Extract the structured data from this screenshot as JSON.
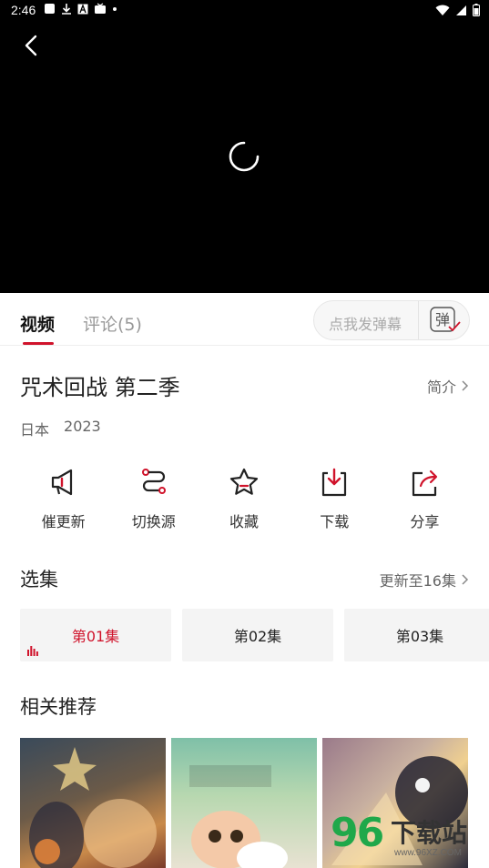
{
  "status_bar": {
    "time": "2:46",
    "left_icons": [
      "app-icon",
      "download-icon",
      "a-icon",
      "tv-icon",
      "dot-icon"
    ],
    "right_icons": [
      "wifi-icon",
      "signal-icon",
      "battery-icon"
    ]
  },
  "player": {
    "back_icon": "chevron-left-icon",
    "loading_icon": "spinner-icon"
  },
  "tabs": [
    {
      "label": "视频",
      "active": true
    },
    {
      "label": "评论(5)",
      "active": false
    }
  ],
  "danmu": {
    "placeholder": "点我发弹幕",
    "button_glyph": "弹"
  },
  "show": {
    "title": "咒术回战 第二季",
    "intro_label": "简介",
    "region": "日本",
    "year": "2023"
  },
  "actions": [
    {
      "label": "催更新",
      "icon": "megaphone-icon"
    },
    {
      "label": "切换源",
      "icon": "switch-source-icon"
    },
    {
      "label": "收藏",
      "icon": "star-icon"
    },
    {
      "label": "下载",
      "icon": "download-icon"
    },
    {
      "label": "分享",
      "icon": "share-icon"
    }
  ],
  "episodes": {
    "section_title": "选集",
    "update_label": "更新至16集",
    "items": [
      {
        "label": "第01集",
        "active": true
      },
      {
        "label": "第02集",
        "active": false
      },
      {
        "label": "第03集",
        "active": false
      }
    ]
  },
  "recommend": {
    "section_title": "相关推荐"
  },
  "watermark": {
    "number": "96",
    "text": "下载站",
    "url": "www.96XZ.COM"
  },
  "colors": {
    "accent": "#d0132b",
    "video_bg": "#000000",
    "episode_bg": "#f4f4f4"
  }
}
